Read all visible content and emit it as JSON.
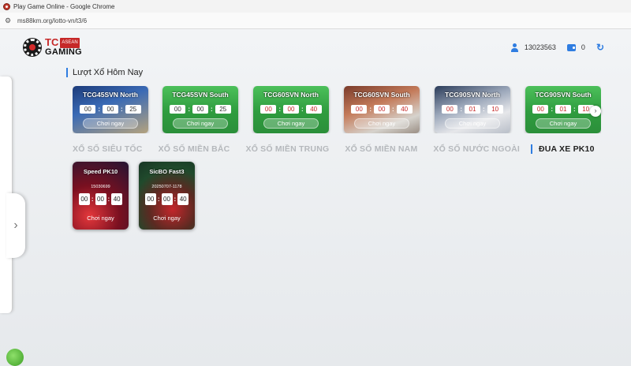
{
  "browser": {
    "window_title": "Play Game Online - Google Chrome",
    "url": "ms88km.org/lotto-vn/t3/6"
  },
  "header": {
    "logo_tc": "TC",
    "logo_asean": "ASEAN",
    "logo_gaming": "GAMING",
    "user_id": "13023563",
    "balance": "0"
  },
  "section_title": "Lượt Xổ Hôm Nay",
  "games": [
    {
      "name": "TCG45SVN North",
      "h": "00",
      "m": "00",
      "s": "25",
      "play": "Chơi ngay"
    },
    {
      "name": "TCG45SVN South",
      "h": "00",
      "m": "00",
      "s": "25",
      "play": "Chơi ngay"
    },
    {
      "name": "TCG60SVN North",
      "h": "00",
      "m": "00",
      "s": "40",
      "play": "Chơi ngay"
    },
    {
      "name": "TCG60SVN South",
      "h": "00",
      "m": "00",
      "s": "40",
      "play": "Chơi ngay"
    },
    {
      "name": "TCG90SVN North",
      "h": "00",
      "m": "01",
      "s": "10",
      "play": "Chơi ngay"
    },
    {
      "name": "TCG90SVN South",
      "h": "00",
      "m": "01",
      "s": "10",
      "play": "Chơi ngay"
    }
  ],
  "tabs": [
    "XỔ SỐ SIÊU TỐC",
    "XỔ SỐ MIỀN BẮC",
    "XỔ SỐ MIỀN TRUNG",
    "XỔ SỐ MIỀN NAM",
    "XỔ SỐ NƯỚC NGOÀI",
    "ĐUA XE PK10"
  ],
  "pk10": [
    {
      "name": "Speed PK10",
      "draw_id": "15030699",
      "h": "00",
      "m": "00",
      "s": "40",
      "play": "Chơi ngay"
    },
    {
      "name": "SicBO Fast3",
      "draw_id": "20250707-1178",
      "h": "00",
      "m": "00",
      "s": "40",
      "play": "Chơi ngay"
    }
  ],
  "colors": {
    "accent": "#2f7de1",
    "brand_red": "#c62828",
    "green_card": "#3aa84a"
  },
  "icons": [
    "user-icon",
    "wallet-icon",
    "refresh-icon",
    "chevron-right-icon",
    "chevron-left-icon"
  ]
}
